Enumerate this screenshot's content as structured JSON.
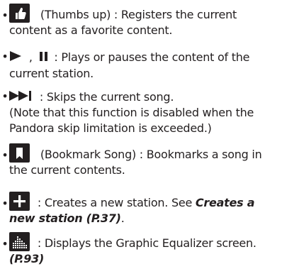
{
  "items": [
    {
      "icon": "thumbs-up-icon",
      "line1": "(Thumbs up) : Registers the current",
      "line2": "content as a favorite content."
    },
    {
      "icons": [
        "play-icon",
        "pause-icon"
      ],
      "sep": ",",
      "line1": ": Plays or pauses the content of the",
      "line2": "current station."
    },
    {
      "icon": "skip-icon",
      "line1": ": Skips the current song.",
      "line2": "(Note that this function is disabled when the",
      "line3": "Pandora skip limitation is exceeded.)"
    },
    {
      "icon": "bookmark-icon",
      "line1": "(Bookmark Song) : Bookmarks a song in",
      "line2": "the current contents."
    },
    {
      "icon": "plus-icon",
      "line1": ": Creates a new station. See",
      "link1": "Creates a",
      "link2": "new station (P.37)",
      "tail": "."
    },
    {
      "icon": "equalizer-icon",
      "line1": ": Displays the Graphic Equalizer screen.",
      "link": "(P.93)"
    }
  ],
  "bullet": "•"
}
